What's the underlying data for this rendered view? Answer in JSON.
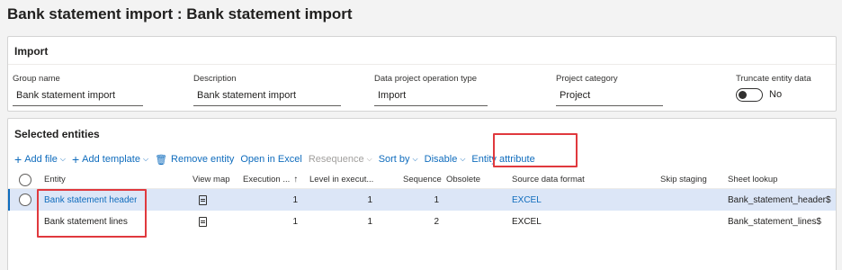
{
  "page": {
    "title": "Bank statement import : Bank statement import"
  },
  "import_section": {
    "title": "Import",
    "fields": {
      "group_name": {
        "label": "Group name",
        "value": "Bank statement import"
      },
      "description": {
        "label": "Description",
        "value": "Bank statement import"
      },
      "operation_type": {
        "label": "Data project operation type",
        "value": "Import"
      },
      "project_category": {
        "label": "Project category",
        "value": "Project"
      },
      "truncate": {
        "label": "Truncate entity data",
        "value": "No",
        "on": false
      }
    }
  },
  "entities_section": {
    "title": "Selected entities",
    "toolbar": {
      "add_file": "Add file",
      "add_template": "Add template",
      "remove_entity": "Remove entity",
      "open_in_excel": "Open in Excel",
      "resequence": "Resequence",
      "sort_by": "Sort by",
      "disable": "Disable",
      "entity_attribute": "Entity attribute"
    },
    "columns": {
      "entity": "Entity",
      "view_map": "View map",
      "execution": "Execution ...",
      "level": "Level in execut...",
      "sequence": "Sequence",
      "obsolete": "Obsolete",
      "source_format": "Source data format",
      "skip_staging": "Skip staging",
      "sheet_lookup": "Sheet lookup"
    },
    "rows": [
      {
        "entity": "Bank statement header",
        "execution": "1",
        "level": "1",
        "sequence": "1",
        "source_format": "EXCEL",
        "skip_staging": "",
        "sheet_lookup": "Bank_statement_header$"
      },
      {
        "entity": "Bank statement lines",
        "execution": "1",
        "level": "1",
        "sequence": "2",
        "source_format": "EXCEL",
        "skip_staging": "",
        "sheet_lookup": "Bank_statement_lines$"
      }
    ]
  },
  "colors": {
    "accent": "#0f6cbd",
    "highlight": "#e0393e",
    "selected_row": "#dce6f7"
  },
  "icons": [
    "plus-icon",
    "chevron-down-icon",
    "trash-icon",
    "sort-up-icon",
    "view-map-icon",
    "radio-icon"
  ]
}
